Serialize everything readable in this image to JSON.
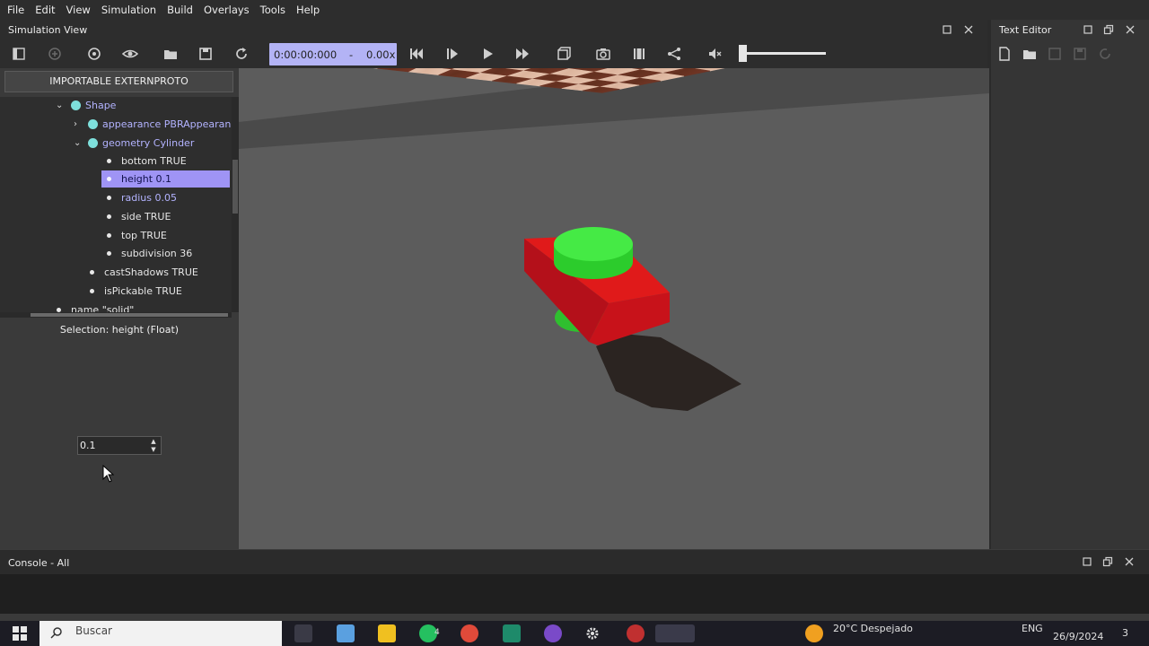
{
  "menu": [
    "File",
    "Edit",
    "View",
    "Simulation",
    "Build",
    "Overlays",
    "Tools",
    "Help"
  ],
  "sim_view": {
    "title": "Simulation View"
  },
  "time": {
    "clock": "0:00:00:000",
    "separator": "-",
    "speed": "0.00x"
  },
  "text_editor": {
    "title": "Text Editor"
  },
  "scene_tree": {
    "extern_button": "IMPORTABLE EXTERNPROTO",
    "nodes": {
      "shape": "Shape",
      "appearance": "appearance PBRAppearance",
      "geometry": "geometry Cylinder",
      "bottom": "bottom TRUE",
      "height": "height 0.1",
      "radius": "radius 0.05",
      "side": "side TRUE",
      "top": "top TRUE",
      "subdivision": "subdivision 36",
      "castShadows": "castShadows TRUE",
      "isPickable": "isPickable TRUE",
      "name": "name \"solid\""
    },
    "selection": "Selection: height (Float)",
    "field_value": "0.1"
  },
  "console": {
    "title": "Console - All"
  },
  "taskbar": {
    "search_placeholder": "Buscar",
    "whatsapp_badge": "4",
    "weather": "20°C  Despejado",
    "lang": "ENG",
    "date": "26/9/2024",
    "notif_count": "3"
  },
  "colors": {
    "selection": "#9f94f5",
    "time_box": "#b3b3f5",
    "node_dot": "#7ee0dc",
    "floor_dark": "#6b3326",
    "floor_light": "#e3c1ad",
    "box_red": "#e0101a",
    "cylinder_green": "#33e633"
  }
}
